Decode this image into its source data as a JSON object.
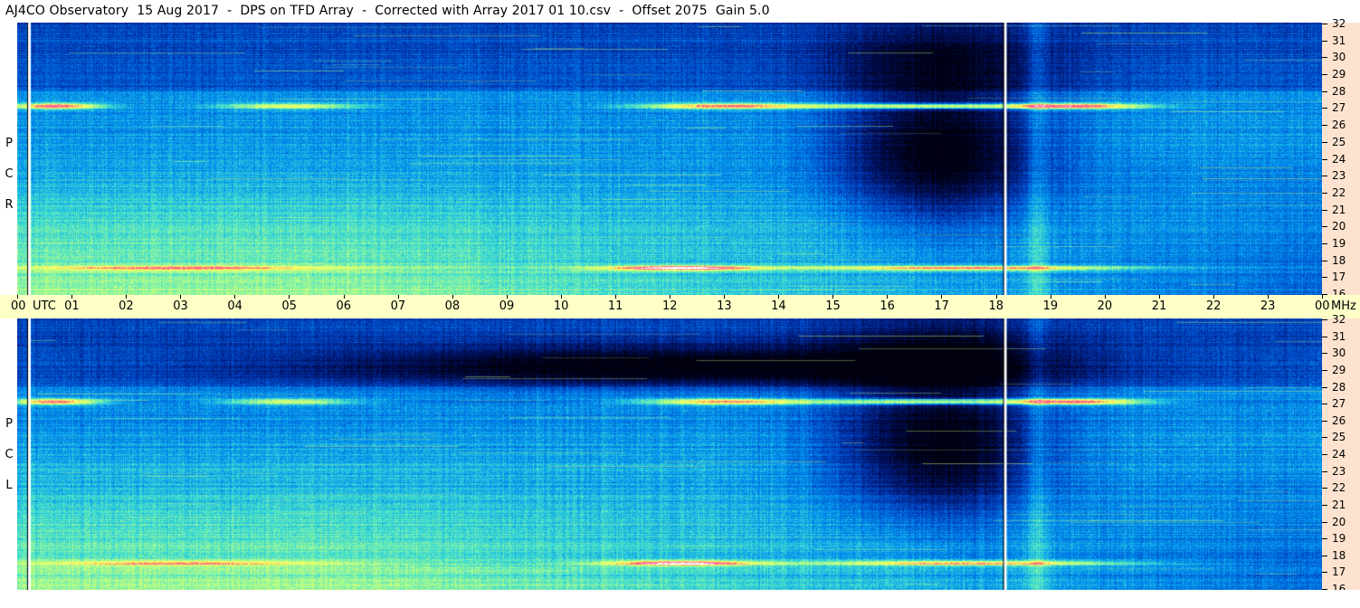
{
  "title": "AJ4CO Observatory  15 Aug 2017  -  DPS on TFD Array  -  Corrected with Array 2017 01 10.csv  -  Offset 2075  Gain 5.0",
  "time_axis": {
    "labels": [
      "00",
      "01",
      "02",
      "03",
      "04",
      "05",
      "06",
      "07",
      "08",
      "09",
      "10",
      "11",
      "12",
      "13",
      "14",
      "15",
      "16",
      "17",
      "18",
      "19",
      "20",
      "21",
      "22",
      "23",
      "00"
    ],
    "unit_label": "UTC",
    "freq_unit_label": "MHz"
  },
  "colors": {
    "time_axis_bg": "#ffffc8",
    "freq_axis_bg": "#fde3cf"
  },
  "chart_data": [
    {
      "type": "heatmap",
      "panel": "RCP",
      "label_letters": [
        "P",
        "C",
        "R"
      ],
      "x_range_utc_hours": [
        0,
        24
      ],
      "y_range_mhz": [
        16,
        32
      ],
      "y_ticks": [
        32,
        31,
        30,
        29,
        28,
        27,
        26,
        25,
        24,
        23,
        22,
        21,
        20,
        19,
        18,
        17,
        16
      ],
      "markers_utc_hours": [
        0.2,
        18.15
      ],
      "colormap": [
        "#000010",
        "#001060",
        "#0040c0",
        "#0090f0",
        "#40e0d0",
        "#c0ff80",
        "#ffff60",
        "#ff4080",
        "#ffffff"
      ]
    },
    {
      "type": "heatmap",
      "panel": "LCP",
      "label_letters": [
        "P",
        "C",
        "L"
      ],
      "x_range_utc_hours": [
        0,
        24
      ],
      "y_range_mhz": [
        16,
        32
      ],
      "y_ticks": [
        32,
        31,
        30,
        29,
        28,
        27,
        26,
        25,
        24,
        23,
        22,
        21,
        20,
        19,
        18,
        17,
        16
      ],
      "markers_utc_hours": [
        0.2,
        18.15
      ],
      "colormap": [
        "#000010",
        "#001060",
        "#0040c0",
        "#0090f0",
        "#40e0d0",
        "#c0ff80",
        "#ffff60",
        "#ff4080",
        "#ffffff"
      ]
    }
  ]
}
